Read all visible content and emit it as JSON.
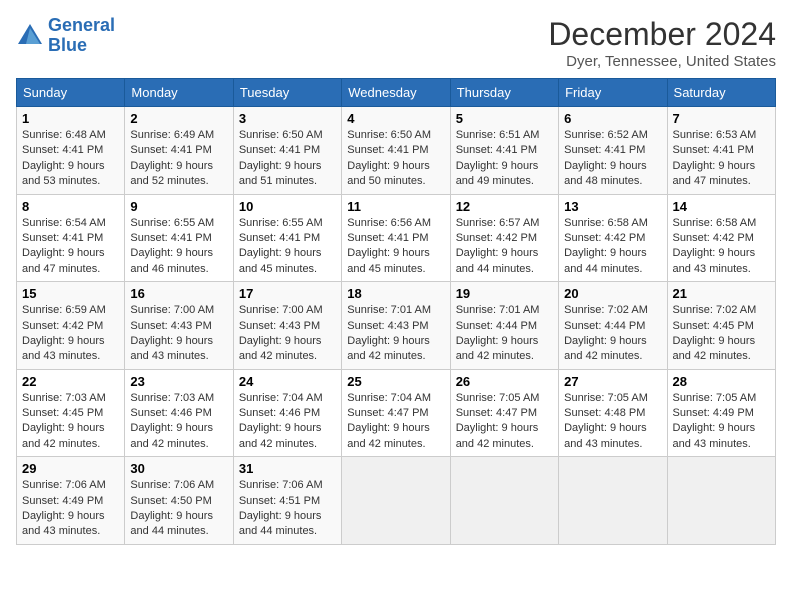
{
  "header": {
    "logo_line1": "General",
    "logo_line2": "Blue",
    "title": "December 2024",
    "subtitle": "Dyer, Tennessee, United States"
  },
  "weekdays": [
    "Sunday",
    "Monday",
    "Tuesday",
    "Wednesday",
    "Thursday",
    "Friday",
    "Saturday"
  ],
  "weeks": [
    [
      {
        "day": 1,
        "sunrise": "6:48 AM",
        "sunset": "4:41 PM",
        "daylight": "9 hours and 53 minutes."
      },
      {
        "day": 2,
        "sunrise": "6:49 AM",
        "sunset": "4:41 PM",
        "daylight": "9 hours and 52 minutes."
      },
      {
        "day": 3,
        "sunrise": "6:50 AM",
        "sunset": "4:41 PM",
        "daylight": "9 hours and 51 minutes."
      },
      {
        "day": 4,
        "sunrise": "6:50 AM",
        "sunset": "4:41 PM",
        "daylight": "9 hours and 50 minutes."
      },
      {
        "day": 5,
        "sunrise": "6:51 AM",
        "sunset": "4:41 PM",
        "daylight": "9 hours and 49 minutes."
      },
      {
        "day": 6,
        "sunrise": "6:52 AM",
        "sunset": "4:41 PM",
        "daylight": "9 hours and 48 minutes."
      },
      {
        "day": 7,
        "sunrise": "6:53 AM",
        "sunset": "4:41 PM",
        "daylight": "9 hours and 47 minutes."
      }
    ],
    [
      {
        "day": 8,
        "sunrise": "6:54 AM",
        "sunset": "4:41 PM",
        "daylight": "9 hours and 47 minutes."
      },
      {
        "day": 9,
        "sunrise": "6:55 AM",
        "sunset": "4:41 PM",
        "daylight": "9 hours and 46 minutes."
      },
      {
        "day": 10,
        "sunrise": "6:55 AM",
        "sunset": "4:41 PM",
        "daylight": "9 hours and 45 minutes."
      },
      {
        "day": 11,
        "sunrise": "6:56 AM",
        "sunset": "4:41 PM",
        "daylight": "9 hours and 45 minutes."
      },
      {
        "day": 12,
        "sunrise": "6:57 AM",
        "sunset": "4:42 PM",
        "daylight": "9 hours and 44 minutes."
      },
      {
        "day": 13,
        "sunrise": "6:58 AM",
        "sunset": "4:42 PM",
        "daylight": "9 hours and 44 minutes."
      },
      {
        "day": 14,
        "sunrise": "6:58 AM",
        "sunset": "4:42 PM",
        "daylight": "9 hours and 43 minutes."
      }
    ],
    [
      {
        "day": 15,
        "sunrise": "6:59 AM",
        "sunset": "4:42 PM",
        "daylight": "9 hours and 43 minutes."
      },
      {
        "day": 16,
        "sunrise": "7:00 AM",
        "sunset": "4:43 PM",
        "daylight": "9 hours and 43 minutes."
      },
      {
        "day": 17,
        "sunrise": "7:00 AM",
        "sunset": "4:43 PM",
        "daylight": "9 hours and 42 minutes."
      },
      {
        "day": 18,
        "sunrise": "7:01 AM",
        "sunset": "4:43 PM",
        "daylight": "9 hours and 42 minutes."
      },
      {
        "day": 19,
        "sunrise": "7:01 AM",
        "sunset": "4:44 PM",
        "daylight": "9 hours and 42 minutes."
      },
      {
        "day": 20,
        "sunrise": "7:02 AM",
        "sunset": "4:44 PM",
        "daylight": "9 hours and 42 minutes."
      },
      {
        "day": 21,
        "sunrise": "7:02 AM",
        "sunset": "4:45 PM",
        "daylight": "9 hours and 42 minutes."
      }
    ],
    [
      {
        "day": 22,
        "sunrise": "7:03 AM",
        "sunset": "4:45 PM",
        "daylight": "9 hours and 42 minutes."
      },
      {
        "day": 23,
        "sunrise": "7:03 AM",
        "sunset": "4:46 PM",
        "daylight": "9 hours and 42 minutes."
      },
      {
        "day": 24,
        "sunrise": "7:04 AM",
        "sunset": "4:46 PM",
        "daylight": "9 hours and 42 minutes."
      },
      {
        "day": 25,
        "sunrise": "7:04 AM",
        "sunset": "4:47 PM",
        "daylight": "9 hours and 42 minutes."
      },
      {
        "day": 26,
        "sunrise": "7:05 AM",
        "sunset": "4:47 PM",
        "daylight": "9 hours and 42 minutes."
      },
      {
        "day": 27,
        "sunrise": "7:05 AM",
        "sunset": "4:48 PM",
        "daylight": "9 hours and 43 minutes."
      },
      {
        "day": 28,
        "sunrise": "7:05 AM",
        "sunset": "4:49 PM",
        "daylight": "9 hours and 43 minutes."
      }
    ],
    [
      {
        "day": 29,
        "sunrise": "7:06 AM",
        "sunset": "4:49 PM",
        "daylight": "9 hours and 43 minutes."
      },
      {
        "day": 30,
        "sunrise": "7:06 AM",
        "sunset": "4:50 PM",
        "daylight": "9 hours and 44 minutes."
      },
      {
        "day": 31,
        "sunrise": "7:06 AM",
        "sunset": "4:51 PM",
        "daylight": "9 hours and 44 minutes."
      },
      null,
      null,
      null,
      null
    ]
  ]
}
